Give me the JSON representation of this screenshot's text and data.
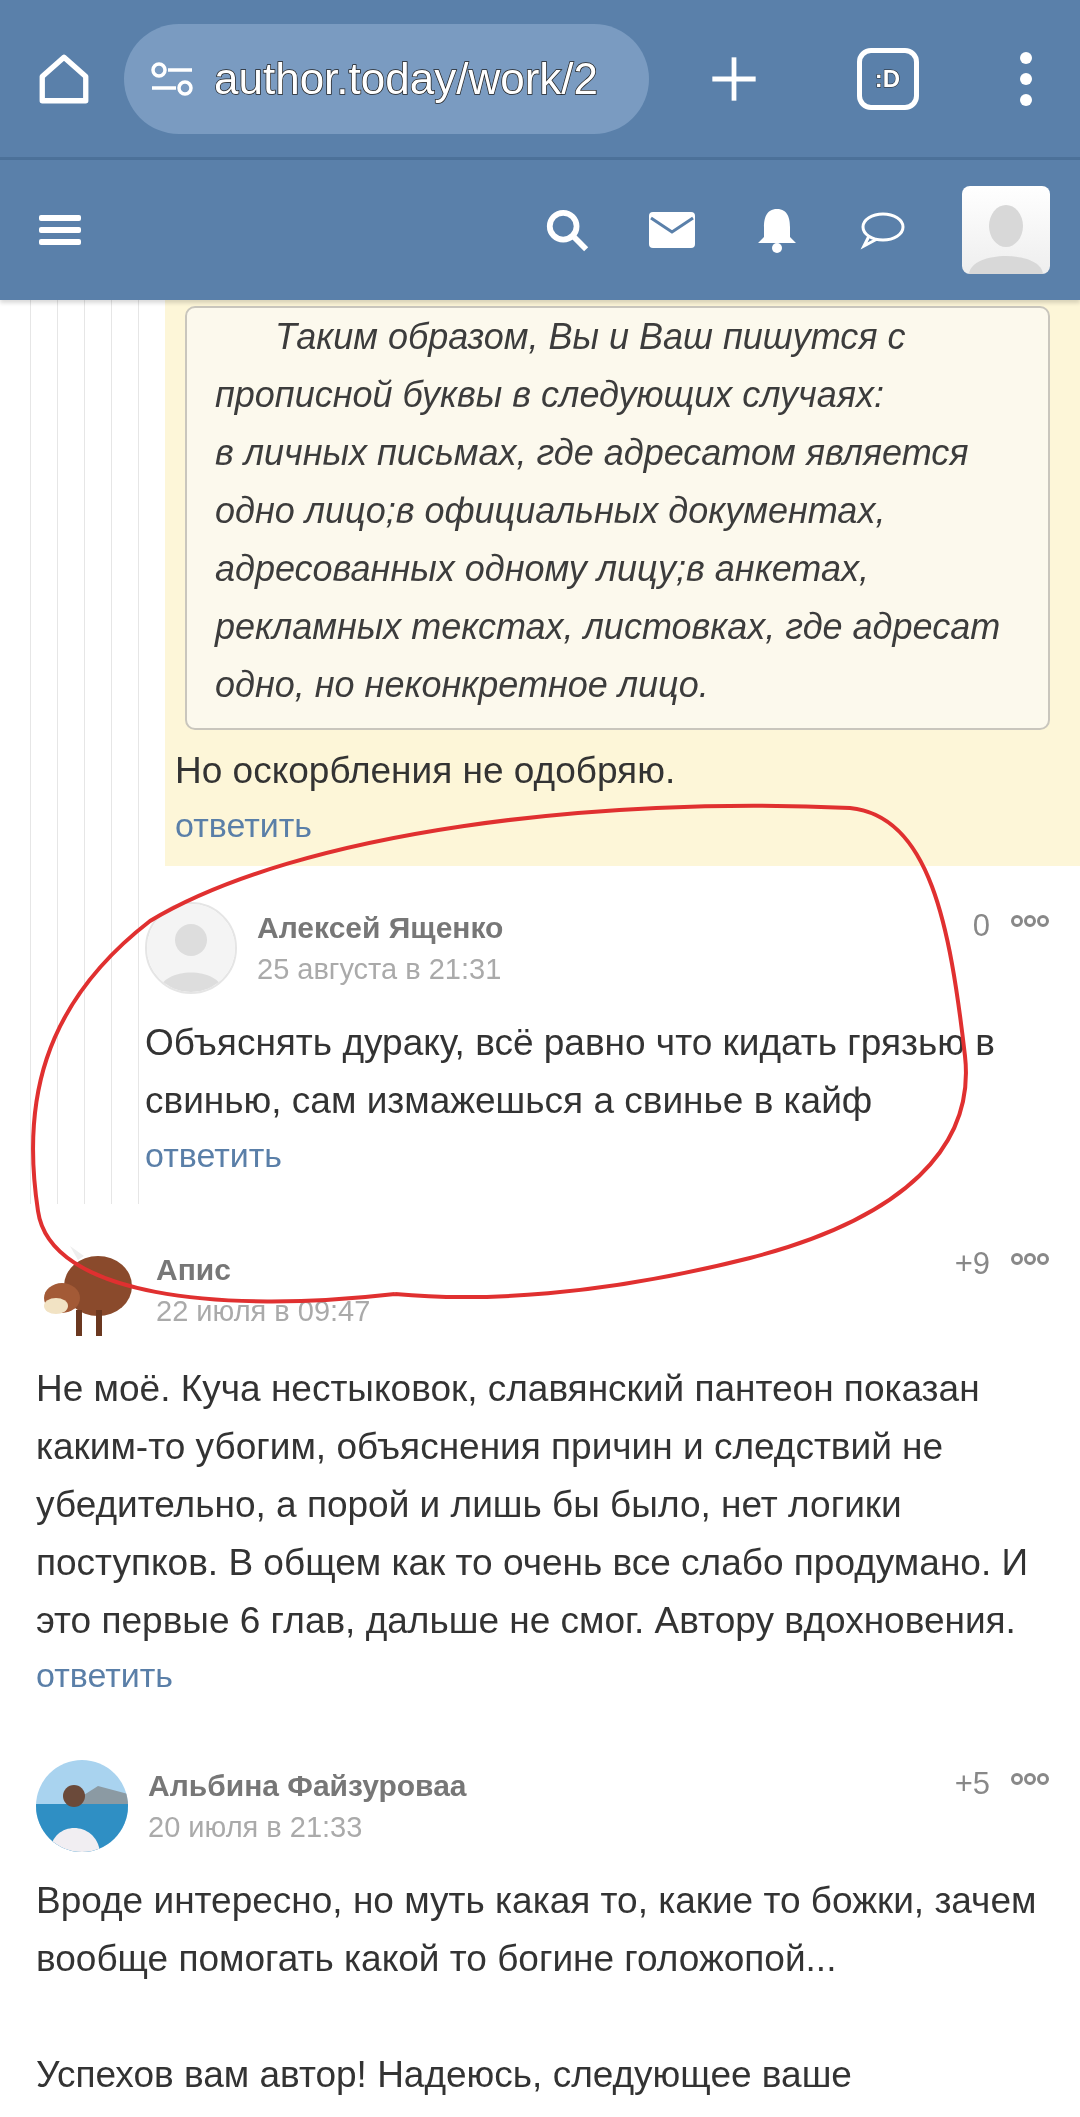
{
  "browser": {
    "url": "author.today/work/2",
    "tab_count": ":D"
  },
  "comments": [
    {
      "kind": "tail",
      "highlighted": true,
      "quote": [
        "Таким образом, Вы и Ваш пишутся с прописной буквы в следующих случаях:",
        "в личных письмах, где адресатом является одно лицо;в официальных документах, адресованных одному лицу;в анкетах, рекламных текстах, листовках, где адресат одно, но неконкретное лицо."
      ],
      "text": [
        "Но оскорбления не одобряю."
      ],
      "reply": "ответить"
    },
    {
      "kind": "reply",
      "highlighted": false,
      "author": "Алексей Ященко",
      "date": "25 августа в 21:31",
      "rating": "0",
      "text": [
        "Объяснять дураку, всё равно что кидать грязью в свинью, сам измажешься а свинье в кайф"
      ],
      "reply": "ответить"
    },
    {
      "kind": "comment",
      "highlighted": false,
      "author": "Апис",
      "date": "22 июля в 09:47",
      "rating": "+9",
      "text": [
        "Не моё. Куча нестыковок, славянский пантеон показан каким-то убогим, объяснения причин и следствий не убедительно, а порой и лишь бы было, нет логики поступков. В общем как то очень все слабо продумано. И это первые 6 глав, дальше не смог. Автору вдохновения."
      ],
      "reply": "ответить"
    },
    {
      "kind": "comment",
      "highlighted": false,
      "author": "Альбина Файзуроваа",
      "date": "20 июля в 21:33",
      "rating": "+5",
      "text": [
        "Вроде интересно, но муть какая то, какие то божки, зачем вообще помогать какой то богине голожопой...",
        "Успехов вам автор! Надеюсь, следующее ваше"
      ]
    }
  ]
}
